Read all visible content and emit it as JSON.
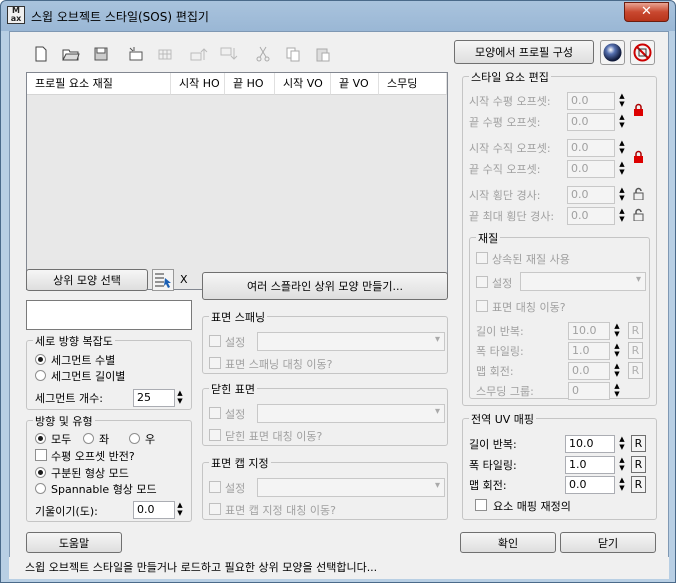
{
  "window": {
    "title": "스윕 오브젝트 스타일(SOS) 편집기",
    "app_icon_text": "Max",
    "close": "✕"
  },
  "toolbar": {
    "icons": [
      "new-file-icon",
      "open-folder-icon",
      "save-icon",
      "add-item-icon",
      "grid-icon",
      "move-up-icon",
      "move-down-icon",
      "cut-icon",
      "copy-icon",
      "paste-icon"
    ],
    "build_from_shape": "모양에서 프로필 구성"
  },
  "list": {
    "columns": [
      "프로필 요소 재질",
      "시작 HO",
      "끝 HO",
      "시작 VO",
      "끝 VO",
      "스무딩"
    ]
  },
  "parent_shape": {
    "select": "상위 모양 선택",
    "clear": "X",
    "value": ""
  },
  "multi_spline": "여러 스플라인 상위 모양 만들기...",
  "vertical_complexity": {
    "title": "세로 방향 복잡도",
    "per_segment_count": "세그먼트 수별",
    "per_segment_length": "세그먼트 길이별",
    "segments_label": "세그먼트 개수:",
    "segments_value": "25"
  },
  "direction": {
    "title": "방향 및 유형",
    "both": "모두",
    "left": "좌",
    "right": "우",
    "flip_h_offset": "수평 오프셋 반전?",
    "sectioned": "구분된 형상 모드",
    "spannable": "Spannable 형상 모드",
    "slope_label": "기울이기(도):",
    "slope_value": "0.0"
  },
  "surface_spanning": {
    "title": "표면 스패닝",
    "set": "설정",
    "mirror": "표면 스패닝 대칭 이동?"
  },
  "closed_surface": {
    "title": "닫힌 표면",
    "set": "설정",
    "mirror": "닫힌 표면 대칭 이동?"
  },
  "surface_cap": {
    "title": "표면 캡 지정",
    "set": "설정",
    "mirror": "표면 캡 지정 대칭 이동?"
  },
  "style_edit": {
    "title": "스타일 요소 편집",
    "start_h": "시작 수평 오프셋:",
    "end_h": "끝 수평 오프셋:",
    "start_v": "시작 수직 오프셋:",
    "end_v": "끝 수직 오프셋:",
    "start_slope": "시작 횡단 경사:",
    "end_slope": "끝 최대 횡단 경사:",
    "values": [
      "0.0",
      "0.0",
      "0.0",
      "0.0",
      "0.0",
      "0.0"
    ]
  },
  "material": {
    "title": "재질",
    "inherit": "상속된 재질 사용",
    "set": "설정",
    "mirror": "표면 대칭 이동?",
    "length_repeat": "길이 반복:",
    "length_value": "10.0",
    "width_tiling": "폭 타일링:",
    "width_value": "1.0",
    "map_rotation": "맵 회전:",
    "rotation_value": "0.0",
    "smoothing_group": "스무딩 그룹:",
    "smoothing_value": "0",
    "r": "R"
  },
  "global_uv": {
    "title": "전역 UV 매핑",
    "length_repeat": "길이 반복:",
    "length_value": "10.0",
    "width_tiling": "폭 타일링:",
    "width_value": "1.0",
    "map_rotation": "맵 회전:",
    "rotation_value": "0.0",
    "remap": "요소 매핑 재정의",
    "r": "R"
  },
  "buttons": {
    "help": "도움말",
    "ok": "확인",
    "close": "닫기"
  },
  "status": "스윕 오브젝트 스타일을 만들거나 로드하고 필요한 상위 모양을 선택합니다..."
}
